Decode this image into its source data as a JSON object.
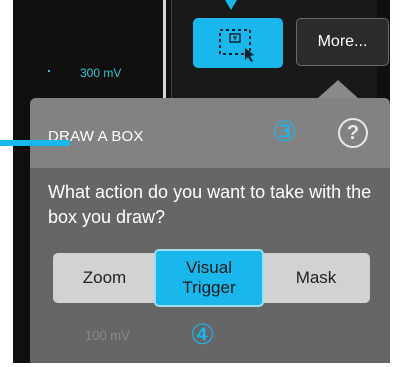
{
  "scope": {
    "trace_label_top": "300 mV",
    "trace_label_bottom": "100 mV"
  },
  "toolbar": {
    "draw_box_icon": "draw-box-icon",
    "more_label": "More..."
  },
  "popup": {
    "title": "DRAW A BOX",
    "help_icon": "help-icon",
    "help_glyph": "?",
    "question": "What action do you want to take with the box you draw?",
    "actions": [
      "Zoom",
      "Visual Trigger",
      "Mask"
    ],
    "selected_action": "Visual Trigger"
  },
  "callouts": {
    "marker_3": "③",
    "marker_4": "④"
  },
  "colors": {
    "accent": "#19b7ec",
    "trace": "#30c7d6",
    "popup_body": "#666666",
    "popup_header": "#828282",
    "segment_bg": "#d2d2d2"
  }
}
